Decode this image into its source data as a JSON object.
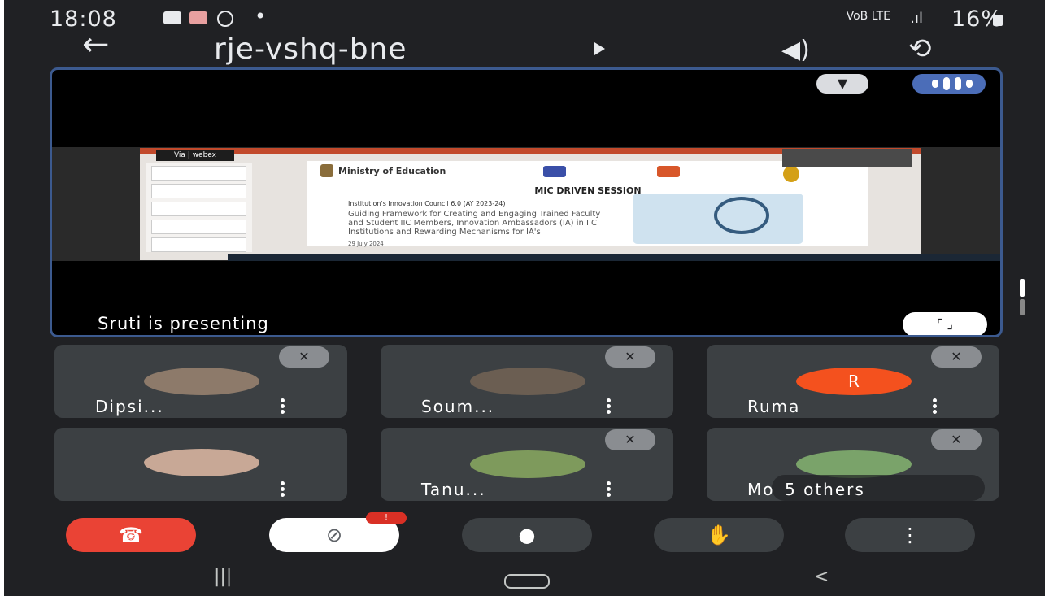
{
  "status_bar": {
    "time": "18:08",
    "dot": "•",
    "signal_text": "VoB LTE",
    "battery": "16%"
  },
  "meeting": {
    "code": "rje-vshq-bne",
    "back_icon": "arrow-left-icon",
    "speaker_icon": "speaker-icon",
    "switch_camera_icon": "switch-camera-icon"
  },
  "presentation": {
    "presenter_label": "Sruti is presenting",
    "pin_icon": "pin-icon",
    "audio_activity_icon": "audio-activity-icon",
    "fullscreen_icon": "fullscreen-icon",
    "slide": {
      "app": "Via | webex",
      "ministry": "Ministry of Education",
      "heading": "MIC DRIVEN SESSION",
      "subtitle": "Institution's Innovation Council 6.0 (AY 2023-24)",
      "body": "Guiding Framework for Creating and Engaging Trained Faculty and Student IIC Members, Innovation Ambassadors (IA) in IIC Institutions and Rewarding Mechanisms for IA's",
      "date": "29 July 2024"
    }
  },
  "participants": [
    {
      "name": "Dipsi...",
      "muted": true,
      "avatar": "photo",
      "color": "#8d7a6a"
    },
    {
      "name": "Soum...",
      "muted": true,
      "avatar": "photo",
      "color": "#6b5e52"
    },
    {
      "name": "Ruma",
      "muted": true,
      "avatar": "initial",
      "initial": "R",
      "color": "#f4511e"
    },
    {
      "name": "",
      "muted": false,
      "avatar": "photo",
      "color": "#c8a896"
    },
    {
      "name": "Tanu...",
      "muted": true,
      "avatar": "photo",
      "color": "#7e9a5c"
    },
    {
      "name": "Mo",
      "muted": true,
      "avatar": "photo",
      "color": "#7aa36a",
      "others": "5 others"
    }
  ],
  "controls": {
    "end_call_icon": "end-call-icon",
    "camera_off_icon": "camera-off-icon",
    "camera_badge": "!",
    "mic_icon": "mic-icon",
    "raise_hand_icon": "raise-hand-icon",
    "more_icon": "more-vertical-icon"
  },
  "nav": {
    "recents": "|||",
    "back": "<"
  }
}
